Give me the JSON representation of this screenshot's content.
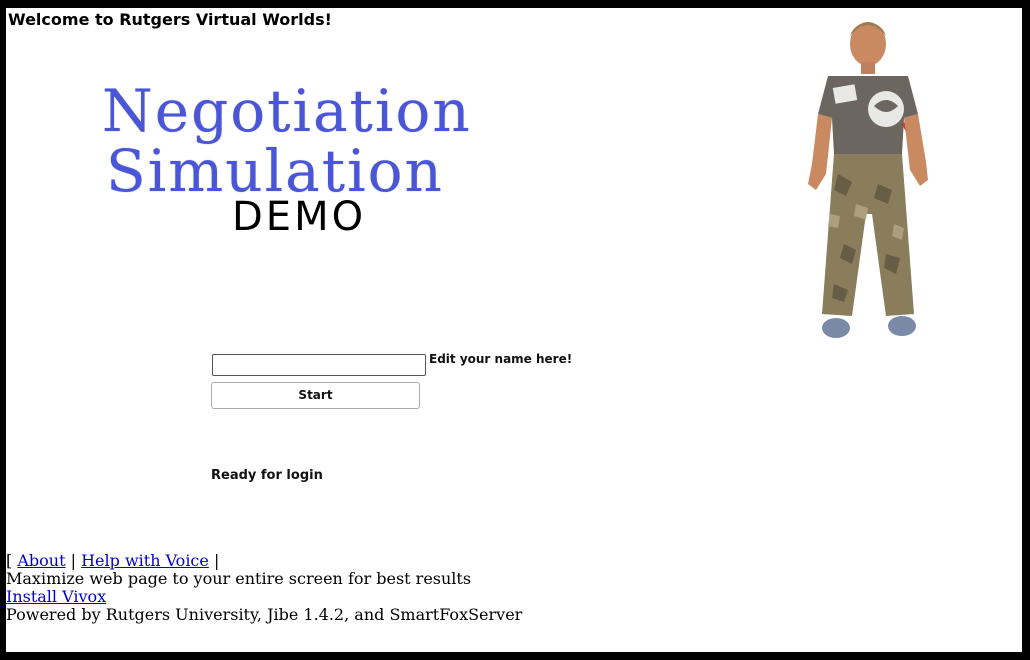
{
  "header": {
    "welcome_text": "Welcome to Rutgers Virtual Worlds!"
  },
  "title": {
    "line1": "Negotiation",
    "line2": "Simulation",
    "line3": "DEMO",
    "color": "#4a56d6"
  },
  "login": {
    "name_value": "",
    "name_hint": "Edit your name here!",
    "start_label": "Start",
    "status_text": "Ready for login"
  },
  "footer": {
    "open_bracket": "[",
    "about_link": "About",
    "separator1": "|",
    "help_link": "Help with Voice",
    "separator2": "|",
    "note": "Maximize web page to your entire screen for best results",
    "install_link": "Install Vivox",
    "powered_by": "Powered by Rutgers University, Jibe 1.4.2, and SmartFoxServer",
    "link_color": "#0000cc"
  },
  "avatar": {
    "icon": "avatar-character-image"
  }
}
